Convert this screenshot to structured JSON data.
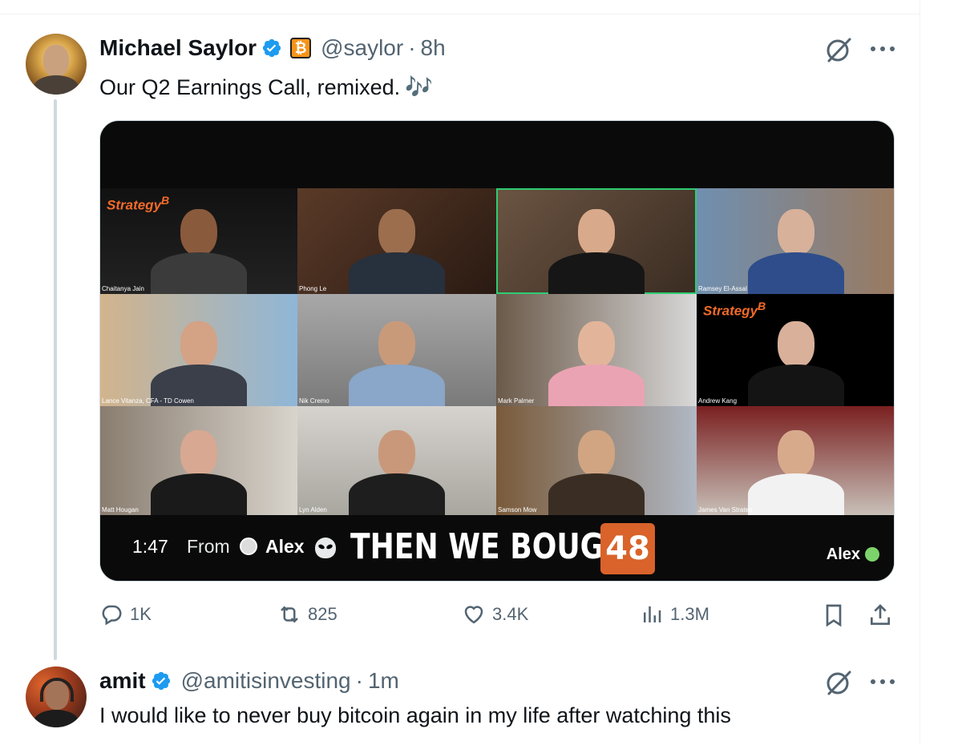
{
  "tweet": {
    "author_name": "Michael Saylor",
    "badge_glyph": "₿",
    "handle": "@saylor",
    "separator": "·",
    "time": "8h",
    "text": "Our Q2 Earnings Call, remixed.",
    "emoji": "🎶",
    "icons": [
      "verified-badge-icon",
      "bitcoin-badge-icon",
      "grok-icon",
      "more-icon"
    ],
    "video": {
      "duration": "1:47",
      "from_label": "From",
      "from_name": "Alex",
      "caption": "THEN WE BOUGHT",
      "caption_number": "48",
      "watermark": "Alex",
      "logo_text": "Strategy",
      "logo_superscript": "B",
      "participants": [
        "Chaitanya Jain",
        "Phong Le",
        "",
        "Ramsey El-Assal",
        "Lance Vitanza, CFA - TD Cowen",
        "Nik Cremo",
        "Mark Palmer",
        "Andrew Kang",
        "Matt Hougan",
        "Lyn Alden",
        "Samson Mow",
        "James Van Straten"
      ]
    },
    "actions": {
      "replies": "1K",
      "reposts": "825",
      "likes": "3.4K",
      "views": "1.3M"
    }
  },
  "reply": {
    "author_name": "amit",
    "handle": "@amitisinvesting",
    "separator": "·",
    "time": "1m",
    "text": "I would like to never buy bitcoin again in my life after watching this"
  },
  "colors": {
    "accent": "#1d9bf0",
    "secondary_text": "#536471",
    "primary_text": "#0f1419",
    "bitcoin_orange": "#f7931a",
    "strategy_orange": "#f26b2a",
    "caption_box": "#d9632a"
  }
}
